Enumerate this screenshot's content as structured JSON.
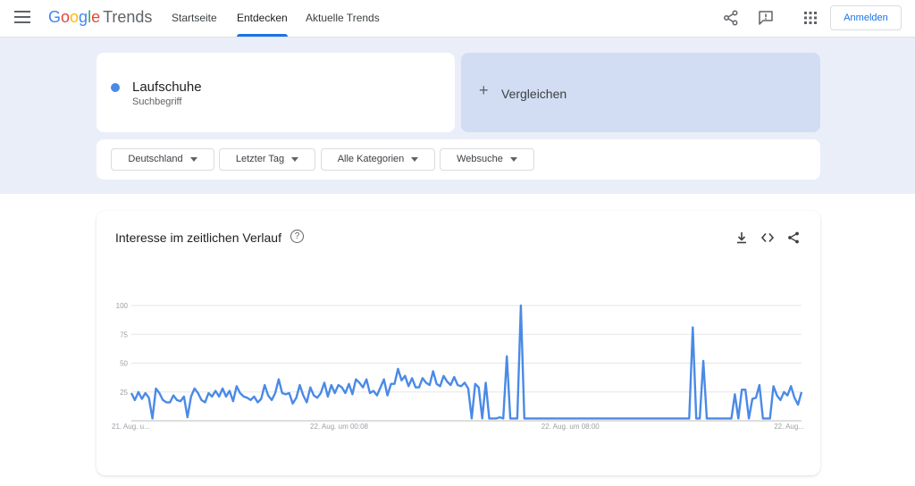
{
  "app": {
    "logo_google": [
      "G",
      "o",
      "o",
      "g",
      "l",
      "e"
    ],
    "logo_trends": "Trends",
    "nav": [
      {
        "label": "Startseite",
        "active": false
      },
      {
        "label": "Entdecken",
        "active": true
      },
      {
        "label": "Aktuelle Trends",
        "active": false
      }
    ],
    "signin_label": "Anmelden",
    "icons": [
      "menu-icon",
      "share-icon",
      "feedback-icon",
      "apps-icon"
    ]
  },
  "search": {
    "term": "Laufschuhe",
    "term_type": "Suchbegriff",
    "term_color": "#4a8ae6",
    "compare_label": "Vergleichen"
  },
  "filters": [
    {
      "label": "Deutschland"
    },
    {
      "label": "Letzter Tag"
    },
    {
      "label": "Alle Kategorien"
    },
    {
      "label": "Websuche"
    }
  ],
  "chart_panel": {
    "title": "Interesse im zeitlichen Verlauf",
    "icons": [
      "help-icon",
      "download-icon",
      "embed-icon",
      "share-icon"
    ]
  },
  "chart_data": {
    "type": "line",
    "title": "Interesse im zeitlichen Verlauf",
    "xlabel": "",
    "ylabel": "",
    "ylim": [
      0,
      100
    ],
    "yticks": [
      25,
      50,
      75,
      100
    ],
    "grid": true,
    "line_color": "#4a8ae6",
    "x_tick_labels": [
      "21. Aug. u...",
      "22. Aug. um 00:08",
      "22. Aug. um 08:00",
      "22. Aug..."
    ],
    "x_tick_positions": [
      0,
      0.31,
      0.655,
      1
    ],
    "series": [
      {
        "values": [
          24,
          18,
          25,
          19,
          24,
          20,
          2,
          28,
          24,
          18,
          16,
          16,
          22,
          18,
          17,
          21,
          3,
          21,
          28,
          24,
          18,
          16,
          24,
          21,
          26,
          21,
          28,
          21,
          26,
          17,
          30,
          24,
          21,
          20,
          18,
          21,
          16,
          19,
          31,
          22,
          18,
          24,
          36,
          24,
          23,
          24,
          15,
          20,
          31,
          22,
          16,
          29,
          22,
          20,
          24,
          33,
          21,
          31,
          24,
          31,
          29,
          24,
          32,
          23,
          36,
          33,
          29,
          36,
          24,
          26,
          22,
          29,
          36,
          22,
          32,
          32,
          45,
          35,
          39,
          30,
          37,
          29,
          29,
          37,
          33,
          31,
          43,
          32,
          30,
          39,
          34,
          31,
          38,
          31,
          30,
          33,
          28,
          2,
          32,
          29,
          2,
          33,
          2,
          2,
          2,
          3,
          2,
          56,
          2,
          2,
          2,
          100,
          2,
          2,
          2,
          2,
          2,
          2,
          2,
          2,
          2,
          2,
          2,
          2,
          2,
          2,
          2,
          2,
          2,
          2,
          2,
          2,
          2,
          2,
          2,
          2,
          2,
          2,
          2,
          2,
          2,
          2,
          2,
          2,
          2,
          2,
          2,
          2,
          2,
          2,
          2,
          2,
          2,
          2,
          2,
          2,
          2,
          2,
          2,
          2,
          81,
          2,
          2,
          52,
          2,
          2,
          2,
          2,
          2,
          2,
          2,
          2,
          23,
          2,
          27,
          27,
          2,
          19,
          20,
          31,
          2,
          2,
          2,
          30,
          22,
          18,
          25,
          22,
          30,
          20,
          14,
          25
        ]
      }
    ]
  }
}
